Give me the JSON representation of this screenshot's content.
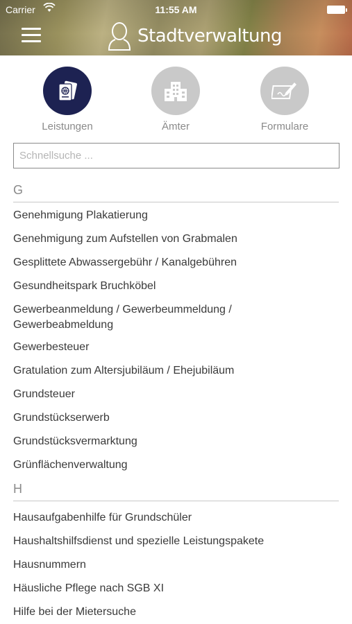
{
  "status_bar": {
    "carrier": "Carrier",
    "time": "11:55 AM"
  },
  "header": {
    "title": "Stadtverwaltung",
    "menu_icon": "hamburger-menu-icon",
    "brand_icon": "person-outline-icon"
  },
  "categories": [
    {
      "label": "Leistungen",
      "icon": "passport-icon",
      "active": true
    },
    {
      "label": "Ämter",
      "icon": "building-icon",
      "active": false
    },
    {
      "label": "Formulare",
      "icon": "form-pen-icon",
      "active": false
    }
  ],
  "search": {
    "placeholder": "Schnellsuche ...",
    "value": ""
  },
  "sections": [
    {
      "letter": "G",
      "items": [
        "Genehmigung Plakatierung",
        "Genehmigung zum Aufstellen von Grabmalen",
        "Gesplittete Abwassergebühr / Kanalgebühren",
        "Gesundheitspark Bruchköbel",
        "Gewerbeanmeldung / Gewerbeummeldung / Gewerbeabmeldung",
        "Gewerbesteuer",
        "Gratulation zum Altersjubiläum / Ehejubiläum",
        "Grundsteuer",
        "Grundstückserwerb",
        "Grundstücksvermarktung",
        "Grünflächenverwaltung"
      ]
    },
    {
      "letter": "H",
      "items": [
        "Hausaufgabenhilfe für Grundschüler",
        "Haushaltshilfsdienst und spezielle Leistungspakete",
        "Hausnummern",
        "Häusliche Pflege nach SGB XI",
        "Hilfe bei der Mietersuche"
      ]
    }
  ],
  "colors": {
    "active_category": "#1d2252",
    "inactive_category": "#c9c9c9",
    "label_grey": "#8a8a8a"
  }
}
